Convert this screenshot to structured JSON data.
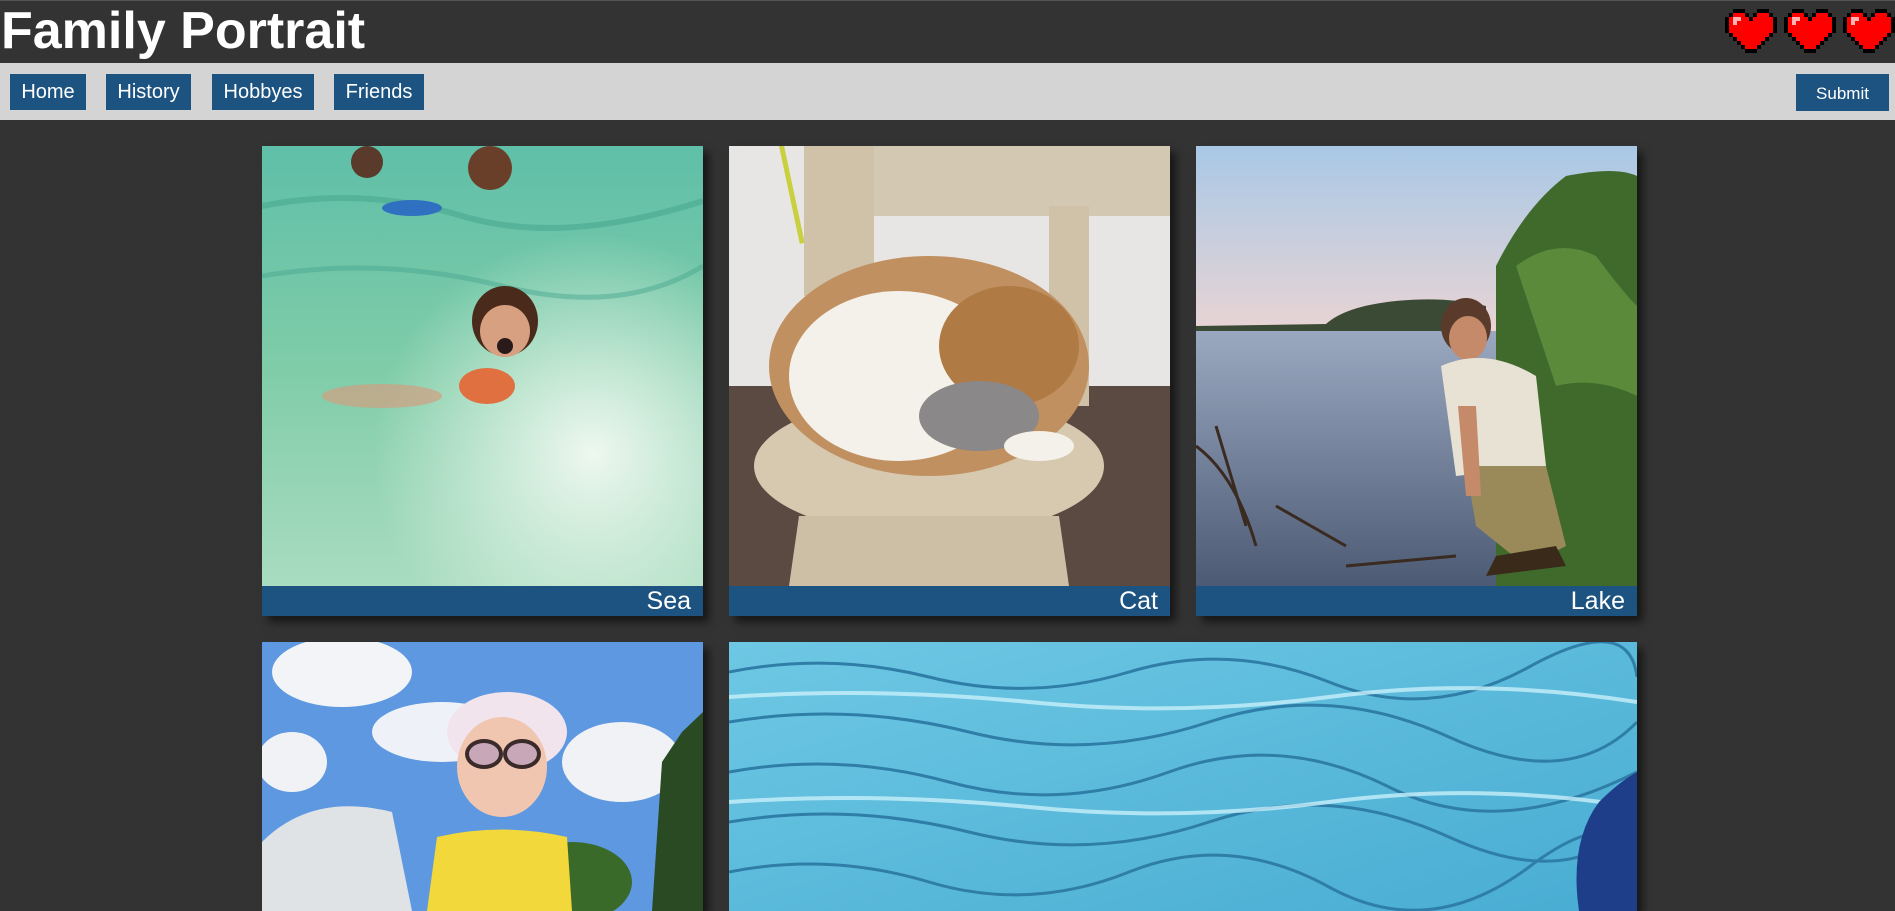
{
  "header": {
    "title": "Family Portrait",
    "hearts": [
      "heart-icon",
      "heart-icon",
      "heart-icon"
    ],
    "heart_color": "#ff0000"
  },
  "nav": {
    "items": [
      {
        "label": "Home"
      },
      {
        "label": "History"
      },
      {
        "label": "Hobbyes"
      },
      {
        "label": "Friends"
      }
    ],
    "submit_label": "Submit",
    "accent": "#1c5380"
  },
  "gallery": {
    "cards": [
      {
        "caption": "Sea"
      },
      {
        "caption": "Cat"
      },
      {
        "caption": "Lake"
      },
      {
        "caption": ""
      },
      {
        "caption": ""
      }
    ]
  }
}
